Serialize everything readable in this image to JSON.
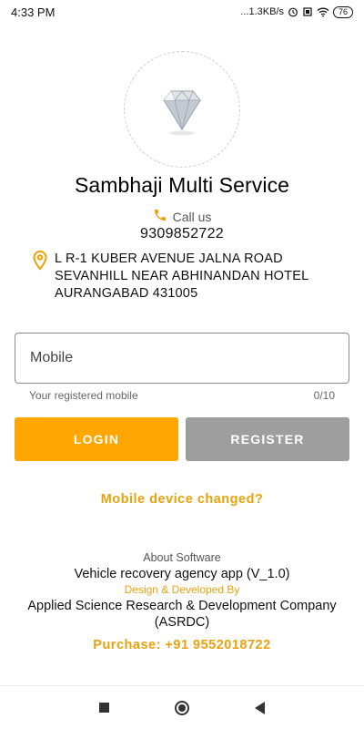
{
  "status_bar": {
    "time": "4:33 PM",
    "network_speed": "...1.3KB/s",
    "battery": "76",
    "icons": [
      "alarm-icon",
      "vibrate-icon",
      "wifi-icon",
      "battery-icon"
    ]
  },
  "business": {
    "name": "Sambhaji Multi Service",
    "call_label": "Call us",
    "phone": "9309852722",
    "address_lines": [
      "L R-1 KUBER AVENUE JALNA ROAD",
      "SEVANHILL NEAR ABHINANDAN HOTEL",
      "AURANGABAD 431005"
    ]
  },
  "form": {
    "mobile_placeholder": "Mobile",
    "mobile_value": "",
    "helper_text": "Your registered mobile",
    "counter": "0/10",
    "login_label": "LOGIN",
    "register_label": "REGISTER",
    "device_changed_link": "Mobile device changed?"
  },
  "about": {
    "title": "About Software",
    "app": "Vehicle recovery agency app (V_1.0)",
    "design_label": "Design & Developed By",
    "company": "Applied Science Research & Development Company (ASRDC)",
    "purchase": "Purchase: +91 9552018722"
  },
  "colors": {
    "accent": "#ffa600",
    "link": "#e8a20e",
    "register_button": "#9e9e9e"
  }
}
